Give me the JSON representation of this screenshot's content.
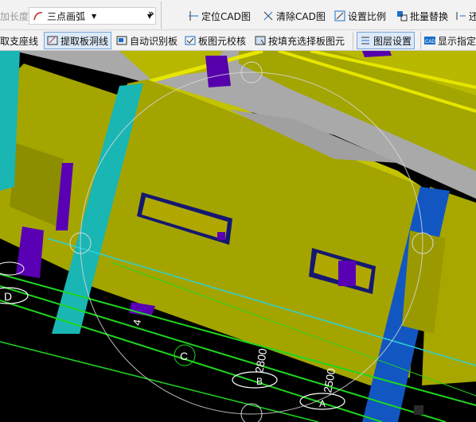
{
  "toolbar_top": {
    "length_label": "加长度",
    "arc_mode": "三点画弧",
    "more_glyph": "»",
    "locate_cad": "定位CAD图",
    "clear_cad": "清除CAD图",
    "set_scale": "设置比例",
    "batch_replace": "批量替换",
    "truncated_item": "还"
  },
  "toolbar_second": {
    "extract_support_line": "取支座线",
    "extract_opening_line": "提取板洞线",
    "auto_identify_slab": "自动识别板",
    "slab_element_check": "板图元校核",
    "fill_select_slab": "按填充选择板图元",
    "layer_settings": "图层设置",
    "show_specified": "显示指定"
  },
  "canvas": {
    "axis_labels": [
      "D",
      "C",
      "B",
      "A"
    ],
    "dimension_labels": [
      "2800",
      "2500"
    ],
    "partial_dimension": "4"
  },
  "colors": {
    "slab_yellow": "#b5b500",
    "beam_cyan": "#18b7b5",
    "column_blue": "#1258c4",
    "opening_purple": "#5a00b4",
    "cad_green": "#25d225",
    "background": "#000000"
  }
}
